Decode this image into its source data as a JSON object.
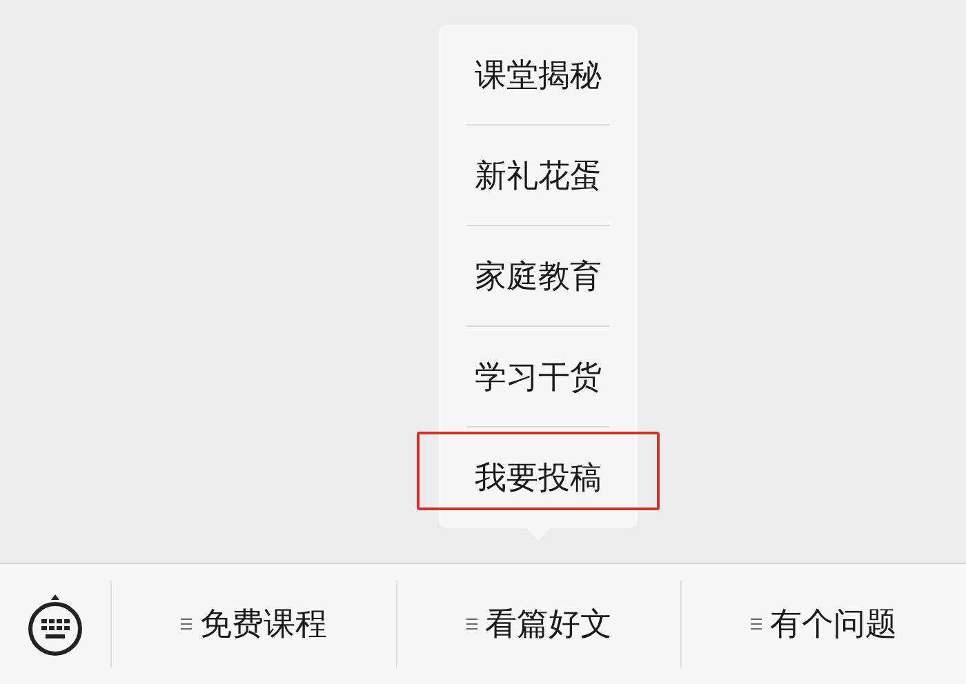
{
  "menu_bar": {
    "items": [
      {
        "label": "免费课程"
      },
      {
        "label": "看篇好文",
        "submenu": [
          {
            "label": "课堂揭秘",
            "highlighted": false
          },
          {
            "label": "新礼花蛋",
            "highlighted": false
          },
          {
            "label": "家庭教育",
            "highlighted": false
          },
          {
            "label": "学习干货",
            "highlighted": false
          },
          {
            "label": "我要投稿",
            "highlighted": true
          }
        ]
      },
      {
        "label": "有个问题"
      }
    ]
  }
}
